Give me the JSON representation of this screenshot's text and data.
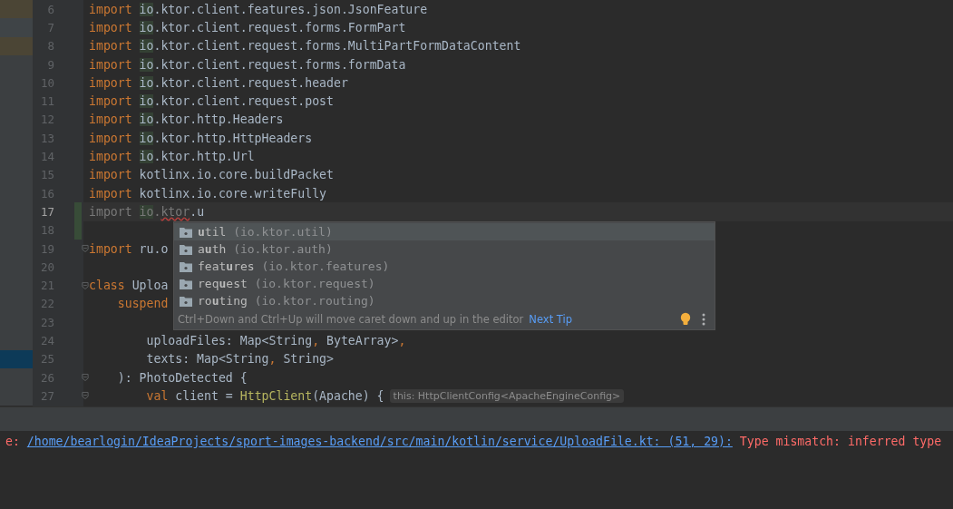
{
  "project_panel": {
    "rows": [
      {
        "color": "#4b4535"
      },
      {
        "color": "#3f4447"
      },
      {
        "color": "#4b4535"
      },
      {
        "color": "#3c3f41"
      },
      {
        "color": "#3c3f41"
      },
      {
        "color": "#3c3f41"
      },
      {
        "color": "#3c3f41"
      },
      {
        "color": "#3c3f41"
      },
      {
        "color": "#3c3f41"
      },
      {
        "color": "#3c3f41"
      },
      {
        "color": "#3c3f41"
      },
      {
        "color": "#3c3f41"
      },
      {
        "color": "#3c3f41"
      },
      {
        "color": "#3c3f41"
      },
      {
        "color": "#3c3f41"
      },
      {
        "color": "#3c3f41"
      },
      {
        "color": "#3c3f41"
      },
      {
        "color": "#3c3f41"
      },
      {
        "color": "#3c3f41"
      },
      {
        "color": "#0d3a58"
      },
      {
        "color": "#3c3f41"
      },
      {
        "color": "#3c3f41"
      }
    ]
  },
  "editor": {
    "lines": [
      {
        "number": "6",
        "current": false,
        "changed": false,
        "fold": false,
        "tokens": [
          {
            "kind": "keyword",
            "text": "import "
          },
          {
            "kind": "highlight",
            "text": "io"
          },
          {
            "kind": "plain",
            "text": ".ktor.client.features.json.JsonFeature"
          }
        ]
      },
      {
        "number": "7",
        "current": false,
        "changed": false,
        "fold": false,
        "tokens": [
          {
            "kind": "keyword",
            "text": "import "
          },
          {
            "kind": "highlight",
            "text": "io"
          },
          {
            "kind": "plain",
            "text": ".ktor.client.request.forms.FormPart"
          }
        ]
      },
      {
        "number": "8",
        "current": false,
        "changed": false,
        "fold": false,
        "tokens": [
          {
            "kind": "keyword",
            "text": "import "
          },
          {
            "kind": "highlight",
            "text": "io"
          },
          {
            "kind": "plain",
            "text": ".ktor.client.request.forms.MultiPartFormDataContent"
          }
        ]
      },
      {
        "number": "9",
        "current": false,
        "changed": false,
        "fold": false,
        "tokens": [
          {
            "kind": "keyword",
            "text": "import "
          },
          {
            "kind": "highlight",
            "text": "io"
          },
          {
            "kind": "plain",
            "text": ".ktor.client.request.forms.formData"
          }
        ]
      },
      {
        "number": "10",
        "current": false,
        "changed": false,
        "fold": false,
        "tokens": [
          {
            "kind": "keyword",
            "text": "import "
          },
          {
            "kind": "highlight",
            "text": "io"
          },
          {
            "kind": "plain",
            "text": ".ktor.client.request.header"
          }
        ]
      },
      {
        "number": "11",
        "current": false,
        "changed": false,
        "fold": false,
        "tokens": [
          {
            "kind": "keyword",
            "text": "import "
          },
          {
            "kind": "highlight",
            "text": "io"
          },
          {
            "kind": "plain",
            "text": ".ktor.client.request.post"
          }
        ]
      },
      {
        "number": "12",
        "current": false,
        "changed": false,
        "fold": false,
        "tokens": [
          {
            "kind": "keyword",
            "text": "import "
          },
          {
            "kind": "highlight",
            "text": "io"
          },
          {
            "kind": "plain",
            "text": ".ktor.http.Headers"
          }
        ]
      },
      {
        "number": "13",
        "current": false,
        "changed": false,
        "fold": false,
        "tokens": [
          {
            "kind": "keyword",
            "text": "import "
          },
          {
            "kind": "highlight",
            "text": "io"
          },
          {
            "kind": "plain",
            "text": ".ktor.http.HttpHeaders"
          }
        ]
      },
      {
        "number": "14",
        "current": false,
        "changed": false,
        "fold": false,
        "tokens": [
          {
            "kind": "keyword",
            "text": "import "
          },
          {
            "kind": "highlight",
            "text": "io"
          },
          {
            "kind": "plain",
            "text": ".ktor.http.Url"
          }
        ]
      },
      {
        "number": "15",
        "current": false,
        "changed": false,
        "fold": false,
        "tokens": [
          {
            "kind": "keyword",
            "text": "import "
          },
          {
            "kind": "plain",
            "text": "kotlinx.io.core.buildPacket"
          }
        ]
      },
      {
        "number": "16",
        "current": false,
        "changed": false,
        "fold": false,
        "tokens": [
          {
            "kind": "keyword",
            "text": "import "
          },
          {
            "kind": "plain",
            "text": "kotlinx.io.core.writeFully"
          }
        ]
      },
      {
        "number": "17",
        "current": true,
        "changed": true,
        "fold": false,
        "tokens": [
          {
            "kind": "unused",
            "text": "import "
          },
          {
            "kind": "unused-highlight",
            "text": "io"
          },
          {
            "kind": "unused",
            "text": "."
          },
          {
            "kind": "error",
            "text": "ktor"
          },
          {
            "kind": "plain",
            "text": ".u"
          }
        ]
      },
      {
        "number": "18",
        "current": false,
        "changed": true,
        "fold": false
      },
      {
        "number": "19",
        "current": false,
        "changed": false,
        "fold": true,
        "tokens": [
          {
            "kind": "keyword",
            "text": "import "
          },
          {
            "kind": "plain",
            "text": "ru.o"
          }
        ]
      },
      {
        "number": "20",
        "current": false,
        "changed": false,
        "fold": false
      },
      {
        "number": "21",
        "current": false,
        "changed": false,
        "fold": true,
        "tokens": [
          {
            "kind": "keyword",
            "text": "class "
          },
          {
            "kind": "plain",
            "text": "Uploa"
          }
        ]
      },
      {
        "number": "22",
        "current": false,
        "changed": false,
        "fold": false,
        "tokens": [
          {
            "kind": "keyword",
            "text": "    suspend"
          }
        ]
      },
      {
        "number": "23",
        "current": false,
        "changed": false,
        "fold": false
      },
      {
        "number": "24",
        "current": false,
        "changed": false,
        "fold": false,
        "tokens": [
          {
            "kind": "plain",
            "text": "        uploadFiles: Map<String"
          },
          {
            "kind": "punct",
            "text": ","
          },
          {
            "kind": "plain",
            "text": " ByteArray>"
          },
          {
            "kind": "punct",
            "text": ","
          }
        ]
      },
      {
        "number": "25",
        "current": false,
        "changed": false,
        "fold": false,
        "tokens": [
          {
            "kind": "plain",
            "text": "        texts: Map<String"
          },
          {
            "kind": "punct",
            "text": ","
          },
          {
            "kind": "plain",
            "text": " String>"
          }
        ]
      },
      {
        "number": "26",
        "current": false,
        "changed": false,
        "fold": true,
        "tokens": [
          {
            "kind": "plain",
            "text": "    ): PhotoDetected {"
          }
        ]
      },
      {
        "number": "27",
        "current": false,
        "changed": false,
        "fold": true,
        "tokens": [
          {
            "kind": "keyword",
            "text": "        val"
          },
          {
            "kind": "plain",
            "text": " client = "
          },
          {
            "kind": "call",
            "text": "HttpClient"
          },
          {
            "kind": "plain",
            "text": "(Apache) {"
          }
        ],
        "hint": "this: HttpClientConfig<ApacheEngineConfig>"
      }
    ]
  },
  "completion": {
    "items": [
      {
        "name": "**u**til",
        "package": "(io.ktor.util)",
        "selected": true
      },
      {
        "name": "a**u**th",
        "package": "(io.ktor.auth)",
        "selected": false
      },
      {
        "name": "feat**u**res",
        "package": "(io.ktor.features)",
        "selected": false
      },
      {
        "name": "req**u**est",
        "package": "(io.ktor.request)",
        "selected": false
      },
      {
        "name": "ro**u**ting",
        "package": "(io.ktor.routing)",
        "selected": false
      }
    ],
    "tip": "Ctrl+Down and Ctrl+Up will move caret down and up in the editor",
    "tip_link": "Next Tip"
  },
  "console": {
    "prefix": "e: ",
    "path": "/home/bearlogin/IdeaProjects/sport-images-backend/src/main/kotlin/service/UploadFile.kt: (51, 29):",
    "message": " Type mismatch: inferred type"
  }
}
